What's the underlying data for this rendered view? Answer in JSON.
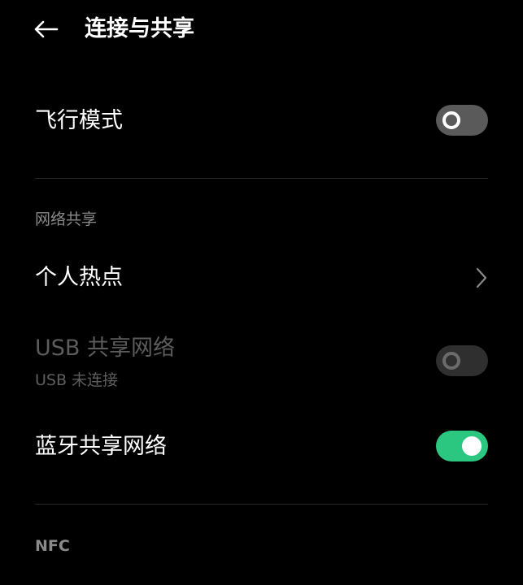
{
  "header": {
    "back_icon": "arrow-left-icon",
    "title": "连接与共享"
  },
  "airplane_mode": {
    "label": "飞行模式",
    "enabled": false
  },
  "tethering_section": {
    "header": "网络共享",
    "hotspot": {
      "label": "个人热点",
      "icon": "chevron-right-icon"
    },
    "usb_tethering": {
      "label": "USB 共享网络",
      "sublabel": "USB 未连接",
      "enabled": false,
      "disabled": true
    },
    "bluetooth_tethering": {
      "label": "蓝牙共享网络",
      "enabled": true
    }
  },
  "nfc_section": {
    "header": "NFC"
  },
  "colors": {
    "background": "#000000",
    "accent": "#2bc781",
    "text_primary": "#ffffff",
    "text_secondary": "#8a8a8a",
    "text_disabled": "#5c5c5c"
  }
}
